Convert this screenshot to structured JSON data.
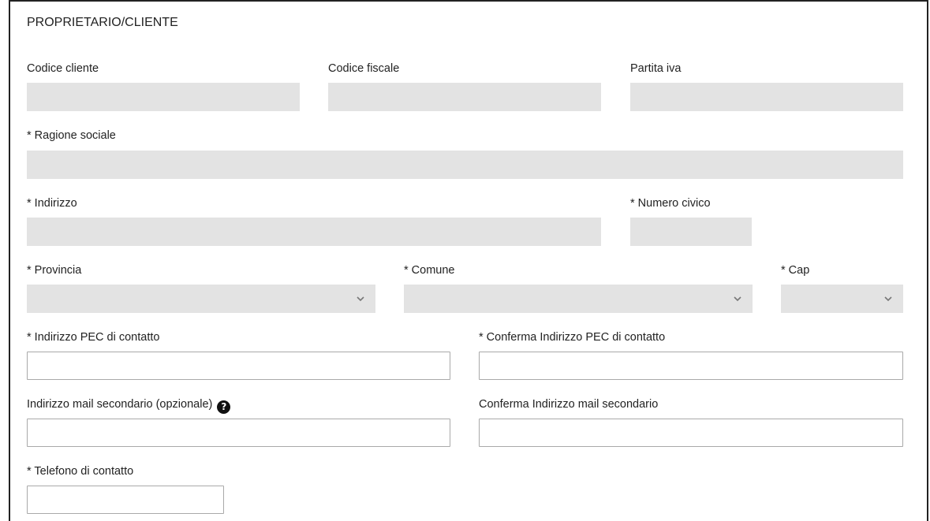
{
  "section": {
    "title": "PROPRIETARIO/CLIENTE"
  },
  "fields": {
    "codice_cliente": {
      "label": "Codice cliente",
      "value": ""
    },
    "codice_fiscale": {
      "label": "Codice fiscale",
      "value": ""
    },
    "partita_iva": {
      "label": "Partita iva",
      "value": ""
    },
    "ragione_sociale": {
      "label": "* Ragione sociale",
      "value": ""
    },
    "indirizzo": {
      "label": "* Indirizzo",
      "value": ""
    },
    "numero_civico": {
      "label": "* Numero civico",
      "value": ""
    },
    "provincia": {
      "label": "* Provincia",
      "selected": ""
    },
    "comune": {
      "label": "* Comune",
      "selected": ""
    },
    "cap": {
      "label": "* Cap",
      "selected": ""
    },
    "pec": {
      "label": "* Indirizzo PEC di contatto",
      "value": ""
    },
    "pec_confirm": {
      "label": "* Conferma Indirizzo PEC di contatto",
      "value": ""
    },
    "mail_secondario": {
      "label": "Indirizzo mail secondario (opzionale)",
      "value": "",
      "help_icon": "question-circle-icon"
    },
    "mail_secondario_confirm": {
      "label": "Conferma Indirizzo mail secondario",
      "value": ""
    },
    "telefono": {
      "label": "* Telefono di contatto",
      "value": ""
    }
  },
  "icons": {
    "help": "?",
    "dropdown": "chevron-down-icon"
  },
  "colors": {
    "disabled_field": "#e3e3e3",
    "enabled_border": "#a9a9a9",
    "text": "#222222"
  }
}
